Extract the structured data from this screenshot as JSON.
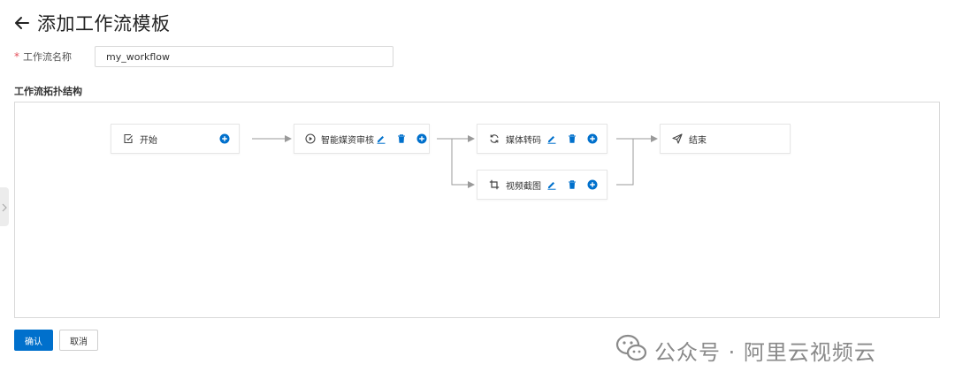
{
  "header": {
    "title": "添加工作流模板",
    "back_icon": "arrow-left-icon"
  },
  "form": {
    "name_label": "工作流名称",
    "required_mark": "*",
    "name_value": "my_workflow"
  },
  "topology": {
    "section_title": "工作流拓扑结构",
    "nodes": [
      {
        "label": "开始",
        "icon": "edit-square-icon",
        "actions": [
          "add"
        ]
      },
      {
        "label": "智能媒资审核",
        "icon": "play-circle-icon",
        "actions": [
          "edit",
          "delete",
          "add"
        ]
      },
      {
        "label": "媒体转码",
        "icon": "sync-icon",
        "actions": [
          "edit",
          "delete",
          "add"
        ]
      },
      {
        "label": "视频截图",
        "icon": "crop-icon",
        "actions": [
          "edit",
          "delete",
          "add"
        ]
      },
      {
        "label": "结束",
        "icon": "send-icon",
        "actions": []
      }
    ]
  },
  "buttons": {
    "confirm": "确认",
    "cancel": "取消"
  },
  "watermark": {
    "text": "公众号 · 阿里云视频云",
    "icon": "wechat-icon"
  },
  "colors": {
    "primary": "#0070cc",
    "action_icon": "#0070cc",
    "required": "#e34d59",
    "border": "#d9d9d9",
    "connector": "#9a9a9a"
  }
}
